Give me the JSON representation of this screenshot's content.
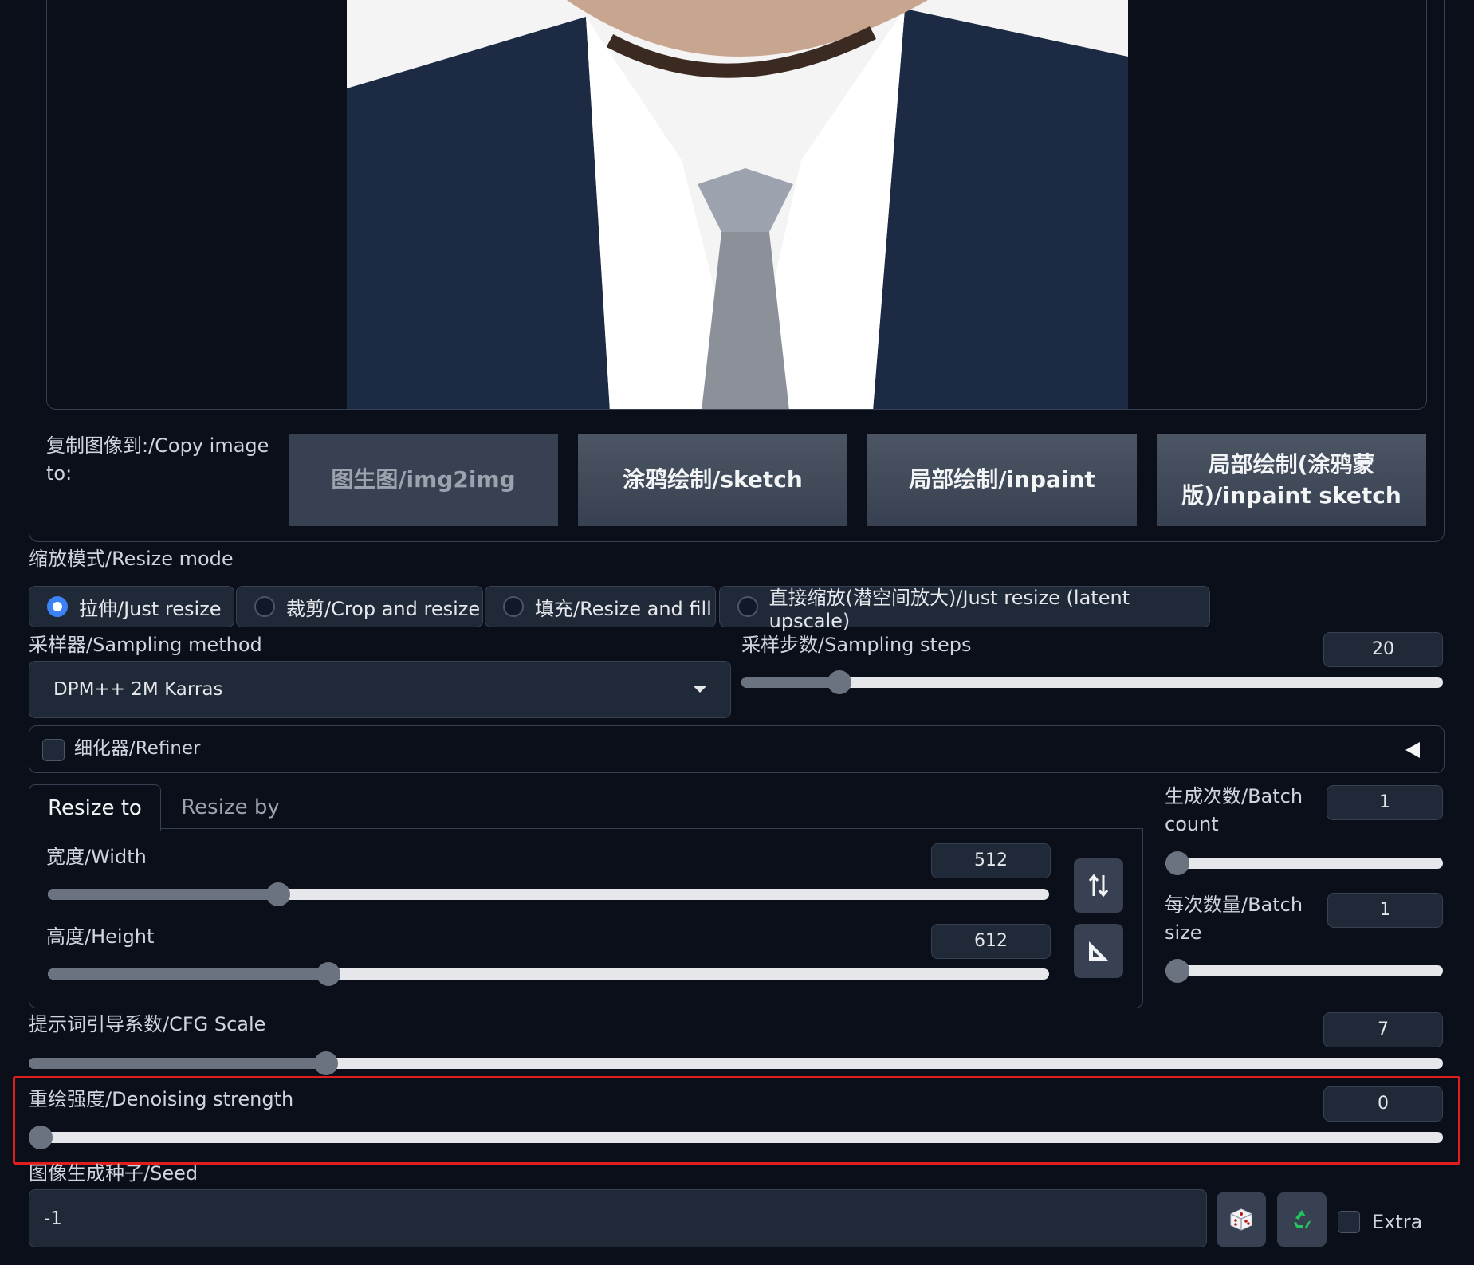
{
  "copy_image": {
    "label": "复制图像到:/Copy image to:",
    "buttons": [
      "图生图/img2img",
      "涂鸦绘制/sketch",
      "局部绘制/inpaint",
      "局部绘制(涂鸦蒙版)/inpaint sketch"
    ]
  },
  "resize_mode": {
    "label": "缩放模式/Resize mode",
    "options": [
      "拉伸/Just resize",
      "裁剪/Crop and resize",
      "填充/Resize and fill",
      "直接缩放(潜空间放大)/Just resize (latent upscale)"
    ],
    "selected": 0
  },
  "sampler": {
    "label": "采样器/Sampling method",
    "value": "DPM++ 2M Karras"
  },
  "steps": {
    "label": "采样步数/Sampling steps",
    "value": "20",
    "fraction": 0.14
  },
  "refiner": {
    "label": "细化器/Refiner"
  },
  "tabs": [
    "Resize to",
    "Resize by"
  ],
  "width": {
    "label": "宽度/Width",
    "value": "512",
    "fraction": 0.23
  },
  "height": {
    "label": "高度/Height",
    "value": "612",
    "fraction": 0.28
  },
  "batch_count": {
    "label": "生成次数/Batch count",
    "value": "1",
    "fraction": 0.0
  },
  "batch_size": {
    "label": "每次数量/Batch size",
    "value": "1",
    "fraction": 0.0
  },
  "cfg": {
    "label": "提示词引导系数/CFG Scale",
    "value": "7",
    "fraction": 0.21
  },
  "denoise": {
    "label": "重绘强度/Denoising strength",
    "value": "0",
    "fraction": 0.0
  },
  "seed": {
    "label": "图像生成种子/Seed",
    "value": "-1",
    "extra_label": "Extra"
  },
  "colors": {
    "accent": "#3b82f6",
    "highlight": "#e11d1d",
    "recycle": "#22c55e"
  }
}
